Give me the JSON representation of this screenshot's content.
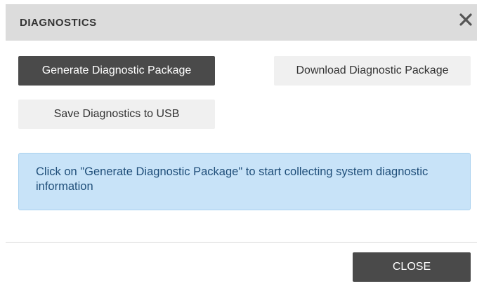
{
  "dialog": {
    "title": "DIAGNOSTICS",
    "close_icon": "close-icon"
  },
  "actions": {
    "generate_label": "Generate Diagnostic Package",
    "download_label": "Download Diagnostic Package",
    "usb_label": "Save Diagnostics to USB"
  },
  "info": {
    "message": "Click on \"Generate Diagnostic Package\" to start collecting system diagnostic information"
  },
  "footer": {
    "close_label": "CLOSE"
  },
  "colors": {
    "header_bg": "#dcdcdc",
    "primary_button": "#4a4a4a",
    "secondary_button": "#f0f0f0",
    "info_bg": "#c8e3f8",
    "info_text": "#1f4e79"
  }
}
